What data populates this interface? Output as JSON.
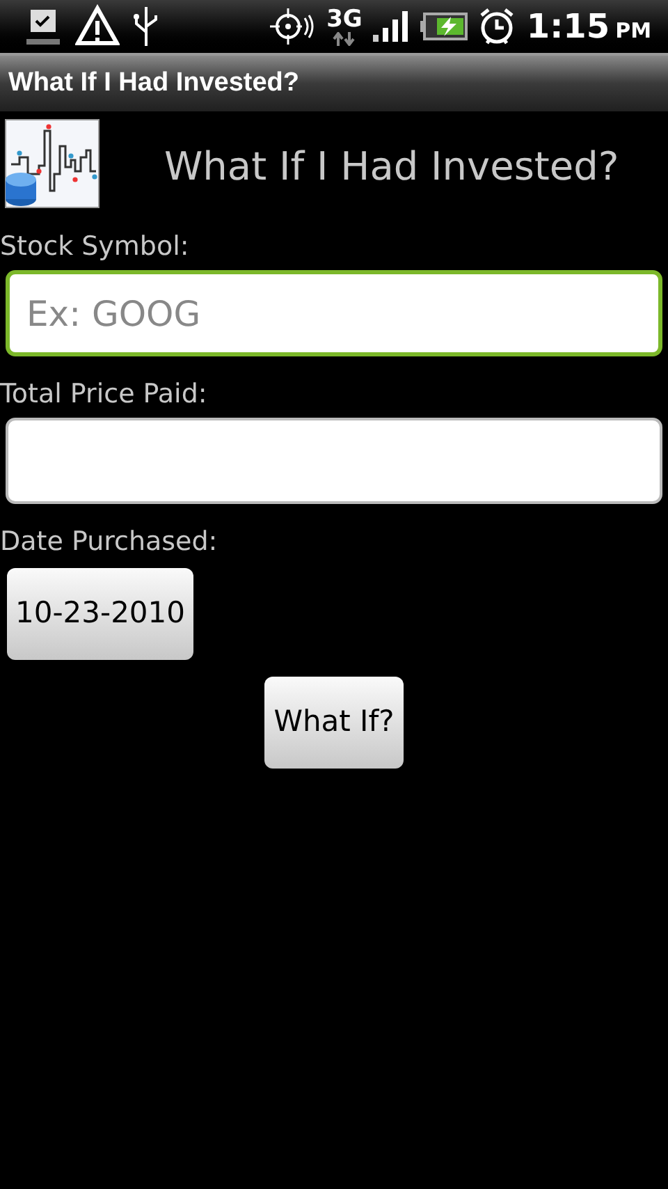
{
  "status_bar": {
    "network": "3G",
    "time": "1:15",
    "ampm": "PM"
  },
  "title_bar": {
    "title": "What If I Had Invested?"
  },
  "header": {
    "title": "What If I Had Invested?"
  },
  "fields": [
    {
      "label": "Stock Symbol:",
      "placeholder": "Ex: GOOG",
      "focused": true
    },
    {
      "label": "Total Price Paid:",
      "focused": false
    }
  ],
  "date": {
    "label": "Date Purchased:",
    "value": "10-23-2010"
  },
  "submit": {
    "label": "What If?"
  }
}
